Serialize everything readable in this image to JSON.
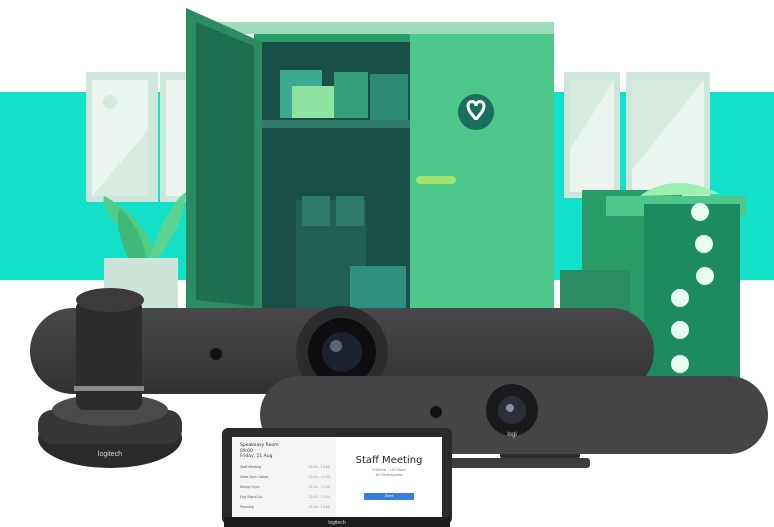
{
  "brand": {
    "camera_logo": "logitech",
    "tablet_logo": "logitech",
    "bar_logo": "logi"
  },
  "tablet": {
    "room_name": "Speakeasy Room",
    "time": "09:00",
    "date": "Friday, 11 Aug",
    "schedule": [
      {
        "label": "Staff Meeting",
        "time": "09:00 - 10:00"
      },
      {
        "label": "Sales Sync Global",
        "time": "10:00 - 11:00"
      },
      {
        "label": "Design Sync",
        "time": "11:00 - 12:00"
      },
      {
        "label": "Eng Stand-Up",
        "time": "12:00 - 13:00"
      },
      {
        "label": "Planning",
        "time": "14:00 - 15:00"
      }
    ],
    "meeting_title": "Staff Meeting",
    "meeting_sub1": "9:00am - 10:00am",
    "meeting_sub2": "All Participants",
    "join_label": "Start"
  },
  "colors": {
    "background": "#ffffff",
    "teal_band": "#12e0c8",
    "cabinet": "#2a9c6a",
    "cabinet_dark": "#1d6b55",
    "door_light": "#4ec78a",
    "device_dark": "#3c3c3e"
  },
  "icons": [
    "heart-badge-icon",
    "plant-icon",
    "window-icon",
    "box-icon"
  ]
}
